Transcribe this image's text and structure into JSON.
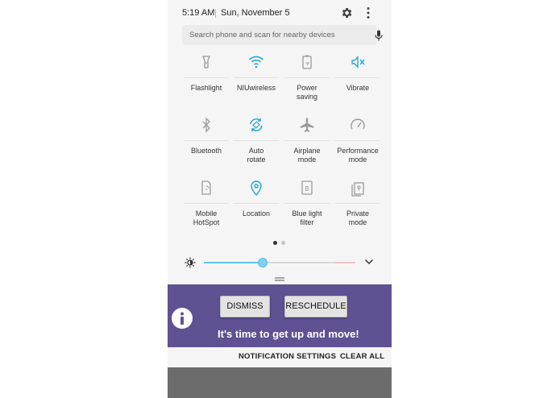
{
  "status_bar": {
    "time": "5:19 AM",
    "date": "Sun, November 5",
    "settings_icon": "gear-icon",
    "more_icon": "kebab-menu-icon"
  },
  "search": {
    "placeholder": "Search phone and scan for nearby devices",
    "mic_icon": "microphone-icon"
  },
  "tiles": [
    {
      "label": "Flashlight",
      "icon": "flashlight-icon",
      "active": false
    },
    {
      "label": "NIUwireless",
      "icon": "wifi-icon",
      "active": true
    },
    {
      "label": "Power\nsaving",
      "icon": "battery-icon",
      "active": false
    },
    {
      "label": "Vibrate",
      "icon": "vibrate-icon",
      "active": true
    },
    {
      "label": "Bluetooth",
      "icon": "bluetooth-icon",
      "active": false
    },
    {
      "label": "Auto\nrotate",
      "icon": "rotate-icon",
      "active": true
    },
    {
      "label": "Airplane\nmode",
      "icon": "airplane-icon",
      "active": false
    },
    {
      "label": "Performance\nmode",
      "icon": "speedometer-icon",
      "active": false
    },
    {
      "label": "Mobile\nHotSpot",
      "icon": "hotspot-icon",
      "active": false
    },
    {
      "label": "Location",
      "icon": "location-icon",
      "active": true
    },
    {
      "label": "Blue light\nfilter",
      "icon": "blue-light-icon",
      "active": false
    },
    {
      "label": "Private\nmode",
      "icon": "private-mode-icon",
      "active": false
    }
  ],
  "pager": {
    "current_page": 1,
    "page_count": 2
  },
  "brightness": {
    "level": 0.39,
    "icon": "brightness-icon"
  },
  "notification": {
    "dismiss_label": "DISMISS",
    "reschedule_label": "RESCHEDULE",
    "message": "It's time to get up and move!",
    "icon": "info-icon",
    "background_color": "#605193"
  },
  "actions": {
    "settings_label": "NOTIFICATION SETTINGS",
    "clear_label": "CLEAR ALL"
  },
  "colors": {
    "accent": "#2aa7cf",
    "inactive_icon": "#9a9a9a"
  }
}
